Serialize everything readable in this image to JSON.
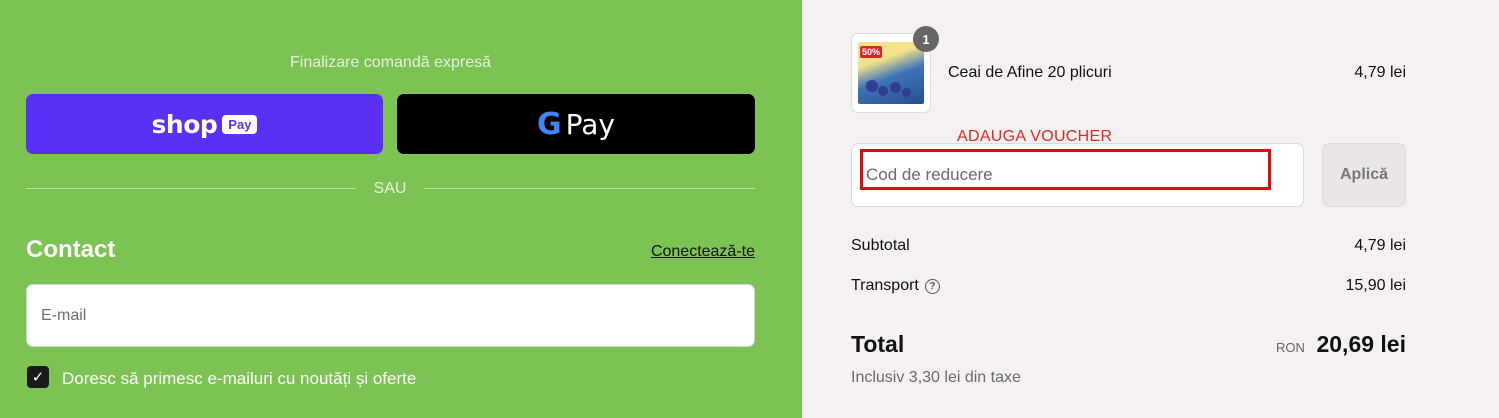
{
  "express": {
    "title": "Finalizare comandă expresă",
    "shop_pay_word": "shop",
    "shop_pay_badge": "Pay",
    "gpay_g": "G",
    "gpay_word": "Pay",
    "separator": "SAU"
  },
  "contact": {
    "heading": "Contact",
    "login_link": "Conectează-te",
    "email_placeholder": "E-mail",
    "newsletter_checked": true,
    "newsletter_label": "Doresc să primesc e-mailuri cu noutăți și oferte"
  },
  "cart": {
    "item": {
      "name": "Ceai de Afine 20 plicuri",
      "price": "4,79 lei",
      "quantity": "1",
      "thumbnail_tag": "50%"
    }
  },
  "discount": {
    "annotation": "ADAUGA VOUCHER",
    "placeholder": "Cod de reducere",
    "apply_label": "Aplică"
  },
  "summary": {
    "subtotal_label": "Subtotal",
    "subtotal_value": "4,79 lei",
    "shipping_label": "Transport",
    "shipping_help_icon": "?",
    "shipping_value": "15,90 lei",
    "total_label": "Total",
    "total_currency": "RON",
    "total_value": "20,69 lei",
    "tax_note": "Inclusiv 3,30 lei din taxe"
  },
  "colors": {
    "left_panel": "#7cc354",
    "shop_pay": "#5a31f4",
    "gpay": "#000000",
    "right_panel": "#f4f1f0",
    "annotation_red": "#e20b0b"
  }
}
